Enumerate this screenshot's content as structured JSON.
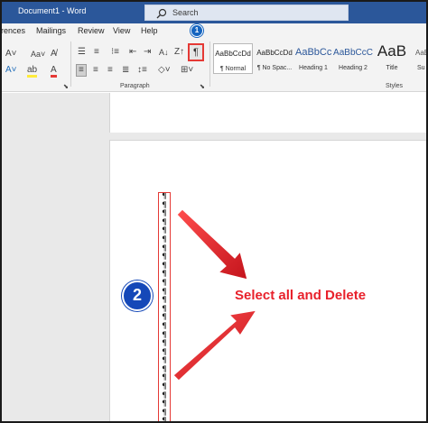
{
  "window": {
    "title": "Document1  -  Word",
    "search_placeholder": "Search"
  },
  "tabs": [
    "rences",
    "Mailings",
    "Review",
    "View",
    "Help"
  ],
  "ribbon": {
    "paragraph_group_label": "Paragraph",
    "styles_group_label": "Styles",
    "show_hide_icon": "pilcrow-icon",
    "styles": [
      {
        "sample": "AaBbCcDd",
        "name": "¶ Normal"
      },
      {
        "sample": "AaBbCcDd",
        "name": "¶ No Spac..."
      },
      {
        "sample": "AaBbCc",
        "name": "Heading 1"
      },
      {
        "sample": "AaBbCcC",
        "name": "Heading 2"
      },
      {
        "sample": "AaB",
        "name": "Title"
      },
      {
        "sample": "AaBbCcD",
        "name": "Su"
      }
    ]
  },
  "annotations": {
    "badge1": "1",
    "badge2": "2",
    "callout": "Select all and Delete",
    "accent_color": "#e53935",
    "badge_color": "#1548b8"
  },
  "document": {
    "pilcrow_glyph": "¶",
    "pilcrow_count": 27
  }
}
